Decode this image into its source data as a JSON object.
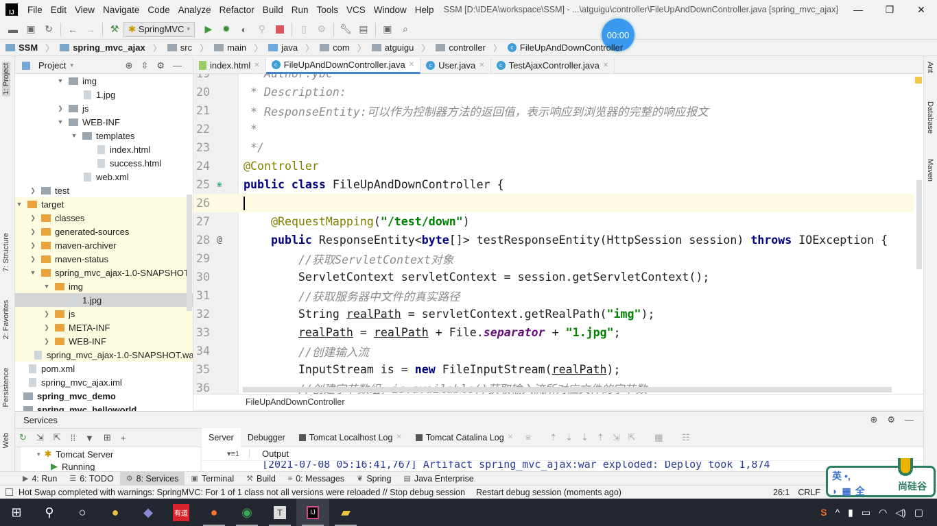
{
  "menubar": {
    "items": [
      "File",
      "Edit",
      "View",
      "Navigate",
      "Code",
      "Analyze",
      "Refactor",
      "Build",
      "Run",
      "Tools",
      "VCS",
      "Window",
      "Help"
    ],
    "title": "SSM [D:\\IDEA\\workspace\\SSM] - ...\\atguigu\\controller\\FileUpAndDownController.java [spring_mvc_ajax]",
    "logo": "IJ"
  },
  "toolbar": {
    "run_config": "SpringMVC"
  },
  "timer": "00:00",
  "breadcrumb": [
    "SSM",
    "spring_mvc_ajax",
    "src",
    "main",
    "java",
    "com",
    "atguigu",
    "controller",
    "FileUpAndDownController"
  ],
  "left_strip": {
    "project": "1: Project",
    "structure": "7: Structure",
    "favorites": "2: Favorites",
    "persistence": "Persistence",
    "web": "Web"
  },
  "right_strip": [
    "Ant",
    "Database",
    "Maven"
  ],
  "project_panel": {
    "title": "Project",
    "tree": [
      {
        "label": "img",
        "level": 3,
        "type": "folder",
        "arrow": "down"
      },
      {
        "label": "1.jpg",
        "level": 4,
        "type": "file"
      },
      {
        "label": "js",
        "level": 3,
        "type": "folder",
        "arrow": "right"
      },
      {
        "label": "WEB-INF",
        "level": 3,
        "type": "folder",
        "arrow": "down"
      },
      {
        "label": "templates",
        "level": 4,
        "type": "folder",
        "arrow": "down"
      },
      {
        "label": "index.html",
        "level": 5,
        "type": "file"
      },
      {
        "label": "success.html",
        "level": 5,
        "type": "file"
      },
      {
        "label": "web.xml",
        "level": 4,
        "type": "file"
      },
      {
        "label": "test",
        "level": 1,
        "type": "folder",
        "arrow": "right"
      },
      {
        "label": "target",
        "level": 0,
        "type": "folder-orange",
        "arrow": "down",
        "hl": true
      },
      {
        "label": "classes",
        "level": 1,
        "type": "folder-orange",
        "arrow": "right",
        "hl": true
      },
      {
        "label": "generated-sources",
        "level": 1,
        "type": "folder-orange",
        "arrow": "right",
        "hl": true
      },
      {
        "label": "maven-archiver",
        "level": 1,
        "type": "folder-orange",
        "arrow": "right",
        "hl": true
      },
      {
        "label": "maven-status",
        "level": 1,
        "type": "folder-orange",
        "arrow": "right",
        "hl": true
      },
      {
        "label": "spring_mvc_ajax-1.0-SNAPSHOT",
        "level": 1,
        "type": "folder-orange",
        "arrow": "down",
        "hl": true
      },
      {
        "label": "img",
        "level": 2,
        "type": "folder-orange",
        "arrow": "down",
        "hl": true
      },
      {
        "label": "1.jpg",
        "level": 3,
        "type": "file",
        "sel": true
      },
      {
        "label": "js",
        "level": 2,
        "type": "folder-orange",
        "arrow": "right",
        "hl": true
      },
      {
        "label": "META-INF",
        "level": 2,
        "type": "folder-orange",
        "arrow": "right",
        "hl": true
      },
      {
        "label": "WEB-INF",
        "level": 2,
        "type": "folder-orange",
        "arrow": "right",
        "hl": true
      },
      {
        "label": "spring_mvc_ajax-1.0-SNAPSHOT.war",
        "level": 1,
        "type": "file",
        "hl": true
      },
      {
        "label": "pom.xml",
        "level": 0,
        "type": "file"
      },
      {
        "label": "spring_mvc_ajax.iml",
        "level": 0,
        "type": "file"
      },
      {
        "label": "spring_mvc_demo",
        "level": -1,
        "type": "module",
        "bold": true
      },
      {
        "label": "spring_mvc_helloworld",
        "level": -1,
        "type": "module",
        "bold": true
      }
    ]
  },
  "editor_tabs": [
    {
      "label": "index.html",
      "icon": "html"
    },
    {
      "label": "FileUpAndDownController.java",
      "icon": "class",
      "active": true
    },
    {
      "label": "User.java",
      "icon": "class"
    },
    {
      "label": "TestAjaxController.java",
      "icon": "class"
    }
  ],
  "code": [
    {
      "n": 19,
      "t": [
        [
          " * Author:ybc",
          "c"
        ]
      ]
    },
    {
      "n": 20,
      "t": [
        [
          " * Description:",
          "c"
        ]
      ]
    },
    {
      "n": 21,
      "t": [
        [
          " * ResponseEntity:可以作为控制器方法的返回值，表示响应到浏览器的完整的响应报文",
          "c"
        ]
      ]
    },
    {
      "n": 22,
      "t": [
        [
          " *",
          "c"
        ]
      ]
    },
    {
      "n": 23,
      "t": [
        [
          " */",
          "c"
        ]
      ]
    },
    {
      "n": 24,
      "t": [
        [
          "@Controller",
          "an"
        ]
      ]
    },
    {
      "n": 25,
      "t": [
        [
          "public class ",
          "kw"
        ],
        [
          "FileUpAndDownController {",
          ""
        ]
      ],
      "gutter": "bean"
    },
    {
      "n": 26,
      "t": [],
      "current": true
    },
    {
      "n": 27,
      "t": [
        [
          "    ",
          ""
        ],
        [
          "@RequestMapping",
          "an"
        ],
        [
          "(",
          ""
        ],
        [
          "\"/test/down\"",
          "st"
        ],
        [
          ")",
          ""
        ]
      ]
    },
    {
      "n": 28,
      "t": [
        [
          "    ",
          ""
        ],
        [
          "public ",
          "kw"
        ],
        [
          "ResponseEntity<",
          ""
        ],
        [
          "byte",
          "kw"
        ],
        [
          "[]> testResponseEntity(HttpSession session) ",
          ""
        ],
        [
          "throws ",
          "kw"
        ],
        [
          "IOException {",
          ""
        ]
      ],
      "gutter": "@"
    },
    {
      "n": 29,
      "t": [
        [
          "        ",
          ""
        ],
        [
          "//获取ServletContext对象",
          "c"
        ]
      ]
    },
    {
      "n": 30,
      "t": [
        [
          "        ServletContext servletContext = session.getServletContext();",
          ""
        ]
      ]
    },
    {
      "n": 31,
      "t": [
        [
          "        ",
          ""
        ],
        [
          "//获取服务器中文件的真实路径",
          "c"
        ]
      ]
    },
    {
      "n": 32,
      "t": [
        [
          "        String ",
          ""
        ],
        [
          "realPath",
          "ul"
        ],
        [
          " = servletContext.getRealPath(",
          ""
        ],
        [
          "\"img\"",
          "st"
        ],
        [
          ");",
          ""
        ]
      ]
    },
    {
      "n": 33,
      "t": [
        [
          "        ",
          ""
        ],
        [
          "realPath",
          "ul"
        ],
        [
          " = ",
          ""
        ],
        [
          "realPath",
          "ul"
        ],
        [
          " + File.",
          ""
        ],
        [
          "separator",
          "sf"
        ],
        [
          " + ",
          ""
        ],
        [
          "\"1.jpg\"",
          "st"
        ],
        [
          ";",
          ""
        ]
      ]
    },
    {
      "n": 34,
      "t": [
        [
          "        ",
          ""
        ],
        [
          "//创建输入流",
          "c"
        ]
      ]
    },
    {
      "n": 35,
      "t": [
        [
          "        InputStream is = ",
          ""
        ],
        [
          "new ",
          "kw"
        ],
        [
          "FileInputStream(",
          ""
        ],
        [
          "realPath",
          "ul"
        ],
        [
          ");",
          ""
        ]
      ]
    },
    {
      "n": 36,
      "t": [
        [
          "        ",
          ""
        ],
        [
          "//创建字节数组，is.available()获取输入流所对应文件的字节数",
          "c"
        ]
      ]
    }
  ],
  "editor_breadcrumb": "FileUpAndDownController",
  "services": {
    "title": "Services",
    "tabs": [
      "Server",
      "Debugger",
      "Tomcat Localhost Log",
      "Tomcat Catalina Log"
    ],
    "tree": [
      "Tomcat Server",
      "Running"
    ],
    "output_label": "Output",
    "output_text": "[2021-07-08 05:16:41,767] Artifact spring_mvc_ajax:war exploded: Deploy took 1,874"
  },
  "bottom_tabs": [
    "4: Run",
    "6: TODO",
    "8: Services",
    "Terminal",
    "Build",
    "0: Messages",
    "Spring",
    "Java Enterprise"
  ],
  "status": {
    "message": "Hot Swap completed with warnings: SpringMVC: For 1 of 1 class not all versions were reloaded // Stop debug session",
    "restart": "Restart debug session (moments ago)",
    "position": "26:1",
    "line_sep": "CRLF"
  },
  "ime": {
    "mode": "英",
    "full": "全",
    "brand": "尚硅谷"
  },
  "taskbar": {
    "youdao": "有道"
  }
}
